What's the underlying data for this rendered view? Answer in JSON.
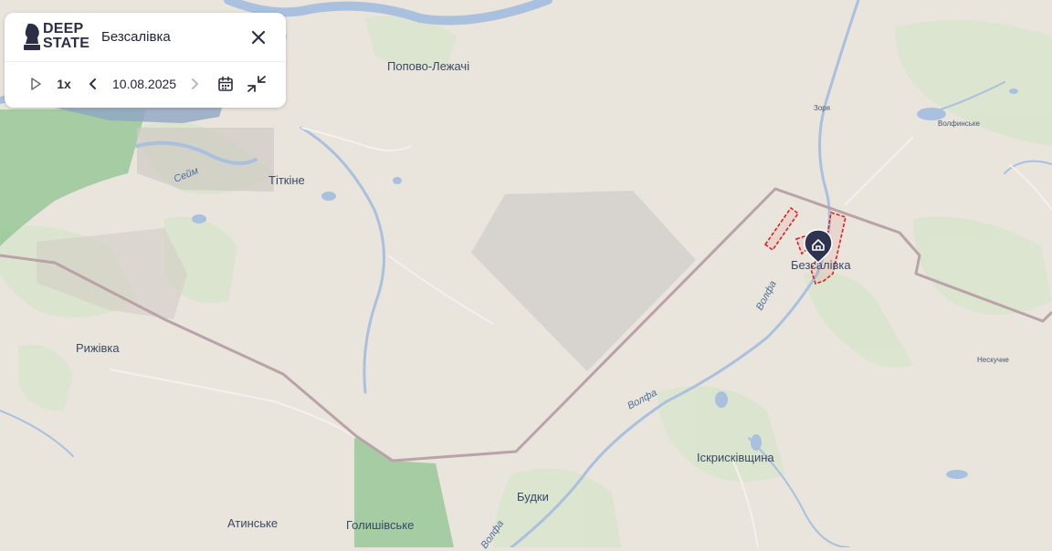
{
  "panel": {
    "logo_line1": "DEEP",
    "logo_line2": "STATE",
    "location_title": "Безсалівка",
    "speed": "1x",
    "date": "10.08.2025"
  },
  "icons": {
    "play": "play-icon",
    "prev": "chevron-left-icon",
    "next": "chevron-right-icon",
    "calendar": "calendar-icon",
    "collapse": "collapse-arrows-icon",
    "close": "close-icon",
    "marker": "home-marker-icon"
  },
  "places": {
    "popovo": "Попово-Лежачі",
    "titkine": "Тіткіне",
    "ryzhivka": "Рижівка",
    "bezsalivka": "Безсалівка",
    "zoria": "Зоря",
    "volfynske": "Волфинське",
    "neskuchne": "Нескучне",
    "iskryskivshchyna": "Іскрисківщина",
    "budky": "Будки",
    "atynske": "Атинське",
    "holyshivske": "Голишівське",
    "river_sejm": "Сейм",
    "river_volfa_1": "Волфа",
    "river_volfa_2": "Волфа",
    "river_volfa_3": "Волфа"
  },
  "colors": {
    "background": "#e9e4dc",
    "water": "#a9c0df",
    "forest": "#cfe0c0",
    "ukraine_green": "#8ec48f",
    "occupied_blue": "#90a6c4",
    "border": "#b9a3a8",
    "restricted_grey": "#d6d2cd",
    "advance_red": "#e02020",
    "marker": "#2e3450"
  }
}
